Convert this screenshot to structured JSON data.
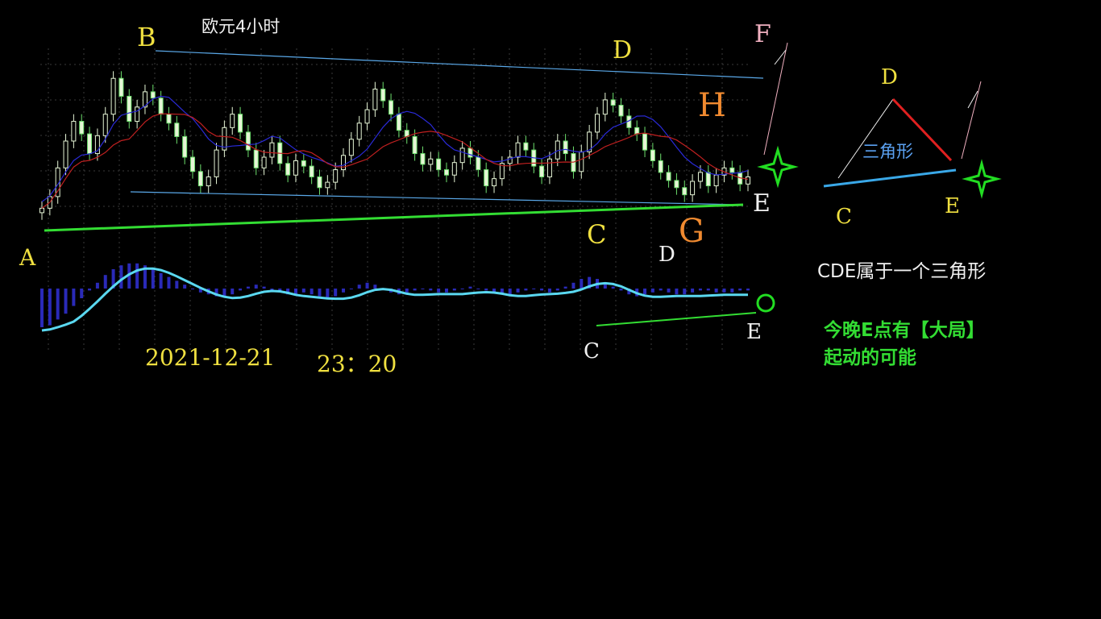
{
  "title": "欧元4小时",
  "date_label": "2021-12-21",
  "time_label": "23：20",
  "colors": {
    "background": "#000000",
    "up_candle": "#e6f5d6",
    "down_candle": "#6ee06e",
    "ma_blue": "#2a2ad8",
    "ma_red": "#c02020",
    "channel_line": "#5aa8e8",
    "support_line": "#33dd33",
    "macd_hist": "#2a2ab8",
    "macd_line": "#5ad8f0",
    "label_yellow": "#f0e040",
    "label_white": "#f0f0f0",
    "label_orange": "#f08a30",
    "label_pink": "#f0b0c0",
    "triangle_red": "#e02020",
    "triangle_blue": "#3aa8e8",
    "triangle_label": "#5aa0f0",
    "note_green": "#33dd33",
    "star_green": "#22dd22"
  },
  "wave_labels": {
    "A": "A",
    "B": "B",
    "C": "C",
    "D": "D",
    "E": "E",
    "F": "F",
    "G": "G",
    "H": "H"
  },
  "macd_labels": {
    "C": "C",
    "D": "D",
    "E": "E"
  },
  "triangle_inset": {
    "label": "三角形",
    "D": "D",
    "C": "C",
    "E": "E"
  },
  "notes": {
    "line1": "CDE属于一个三角形",
    "line2": "今晚E点有【大局】",
    "line3": "起动的可能"
  },
  "icons": {
    "main_star": "green-four-point-star-icon",
    "inset_star": "green-four-point-star-icon",
    "macd_circle": "green-circle-icon"
  },
  "chart_data": [
    {
      "type": "candlestick",
      "title": "欧元4小时",
      "xlabel": "",
      "ylabel": "",
      "grid": true,
      "close": [
        1.05,
        1.18,
        1.5,
        1.8,
        2.02,
        1.88,
        1.66,
        1.86,
        2.1,
        2.5,
        2.3,
        2.02,
        2.18,
        2.35,
        2.28,
        2.1,
        2.0,
        1.85,
        1.62,
        1.46,
        1.3,
        1.4,
        1.7,
        1.95,
        2.1,
        1.9,
        1.7,
        1.5,
        1.62,
        1.78,
        1.55,
        1.42,
        1.58,
        1.52,
        1.4,
        1.28,
        1.34,
        1.48,
        1.64,
        1.82,
        2.0,
        2.15,
        2.38,
        2.25,
        2.1,
        1.92,
        1.85,
        1.66,
        1.54,
        1.6,
        1.48,
        1.42,
        1.56,
        1.72,
        1.62,
        1.48,
        1.3,
        1.38,
        1.55,
        1.62,
        1.78,
        1.7,
        1.52,
        1.4,
        1.6,
        1.8,
        1.66,
        1.46,
        1.68,
        1.9,
        2.1,
        2.26,
        2.2,
        2.08,
        1.95,
        1.88,
        1.7,
        1.58,
        1.45,
        1.36,
        1.28,
        1.2,
        1.35,
        1.45,
        1.3,
        1.42,
        1.5,
        1.45,
        1.32,
        1.4
      ]
    },
    {
      "type": "bar",
      "title": "",
      "xlabel": "",
      "ylabel": "",
      "series": [
        {
          "values": [
            -2.0,
            -1.9,
            -1.6,
            -1.3,
            -0.9,
            -0.5,
            -0.1,
            0.3,
            0.7,
            1.0,
            1.2,
            1.3,
            1.3,
            1.2,
            1.0,
            0.8,
            0.6,
            0.4,
            0.2,
            0.0,
            -0.2,
            -0.3,
            -0.4,
            -0.4,
            -0.3,
            -0.1,
            0.1,
            0.2,
            0.1,
            -0.1,
            -0.2,
            -0.3,
            -0.3,
            -0.2,
            -0.3,
            -0.4,
            -0.5,
            -0.4,
            -0.2,
            0.0,
            0.2,
            0.3,
            0.2,
            0.0,
            -0.2,
            -0.3,
            -0.2,
            -0.1,
            0.0,
            -0.1,
            -0.2,
            -0.2,
            -0.1,
            0.0,
            0.1,
            0.0,
            -0.1,
            -0.2,
            -0.3,
            -0.3,
            -0.2,
            -0.1,
            0.0,
            -0.1,
            -0.2,
            -0.1,
            0.1,
            0.3,
            0.5,
            0.6,
            0.5,
            0.3,
            0.1,
            -0.1,
            -0.3,
            -0.4,
            -0.3,
            -0.2,
            -0.1,
            -0.2,
            -0.3,
            -0.3,
            -0.2,
            -0.1,
            -0.1,
            -0.2,
            -0.2,
            -0.2,
            -0.1,
            -0.1
          ]
        }
      ]
    }
  ]
}
